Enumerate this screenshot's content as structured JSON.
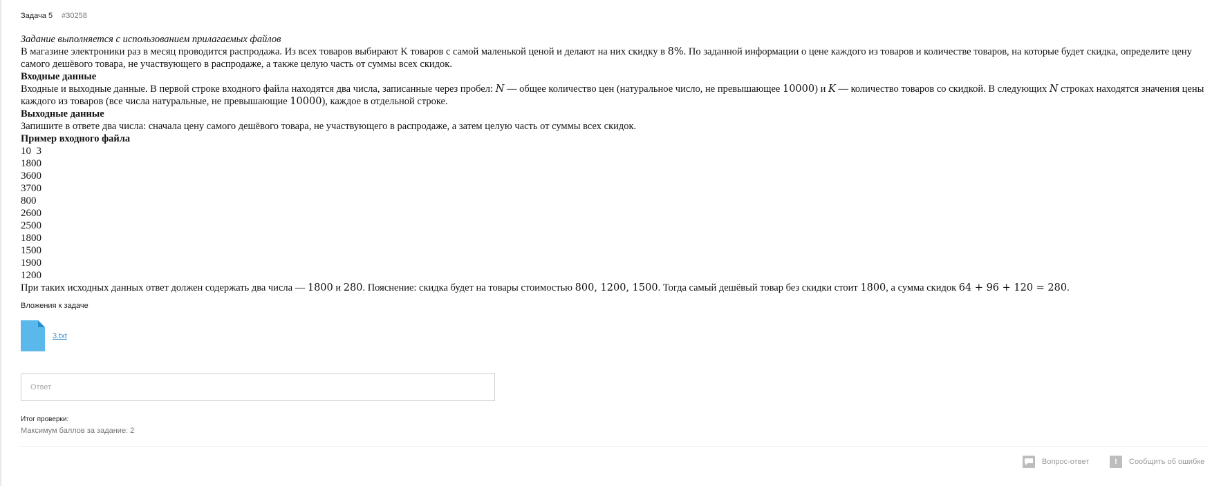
{
  "header": {
    "task_label": "Задача 5",
    "task_id": "#30258"
  },
  "problem": {
    "intro": "Задание выполняется с использованием прилагаемых файлов",
    "statement": {
      "t1": "В магазине электроники раз в месяц проводится распродажа. Из всех товаров выбирают K товаров с самой маленькой ценой и делают на них скидку в ",
      "m1": "8%",
      "t2": ". По заданной информации о цене каждого из товаров и количестве товаров, на которые будет скидка, определите цену самого дешёвого товара, не участвующего в распродаже, а также целую часть от суммы всех скидок."
    },
    "input_title": "Входные данные",
    "input": {
      "t1": "Входные и выходные данные. В первой строке входного файла находятся два числа, записанные через пробел: ",
      "m1": "N",
      "t2": " — общее количество цен (натуральное число, не превышающее ",
      "m2": "10000",
      "t3": ") и ",
      "m3": "K",
      "t4": " — количество товаров со скидкой. В следующих ",
      "m4": "N",
      "t5": " строках находятся значения цены каждого из товаров (все числа натуральные, не превышающие ",
      "m5": "10000",
      "t6": "), каждое в отдельной строке."
    },
    "output_title": "Выходные данные",
    "output": "Запишите в ответе два числа: сначала цену самого дешёвого товара, не участвующего в распродаже, а затем целую часть от суммы всех скидок.",
    "sample_title": "Пример входного файла",
    "sample_lines": [
      "10  3",
      "1800",
      "3600",
      "3700",
      "800",
      "2600",
      "2500",
      "1800",
      "1500",
      "1900",
      "1200"
    ],
    "explanation": {
      "t1": "При таких исходных данных ответ должен содержать два числа — ",
      "m1": "1800",
      "t2": " и ",
      "m2": "280",
      "t3": ". Пояснение: скидка будет на товары стоимостью ",
      "m3": "800, 1200, 1500",
      "t4": ". Тогда самый дешёвый товар без скидки стоит ",
      "m4": "1800",
      "t5": ", а сумма скидок ",
      "m5": "64 + 96 + 120 = 280",
      "t6": "."
    }
  },
  "attachments": {
    "title": "Вложения к задаче",
    "file_name": "3.txt",
    "icon": "file-icon",
    "icon_color": "#5bb8ea"
  },
  "answer": {
    "placeholder": "Ответ",
    "value": ""
  },
  "result": {
    "label": "Итог проверки:",
    "max_score": "Максимум баллов за задание: 2"
  },
  "footer": {
    "qa_label": "Вопрос-ответ",
    "qa_icon": "chat-icon",
    "error_label": "Сообщить об ошибке",
    "error_icon": "exclamation-icon"
  }
}
